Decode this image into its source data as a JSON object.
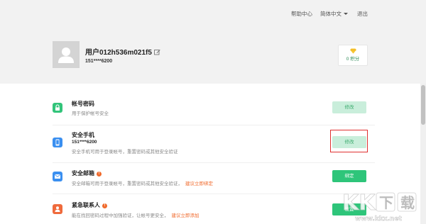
{
  "topnav": {
    "help": "帮助中心",
    "language": "简体中文",
    "logout": "退出"
  },
  "profile": {
    "username": "用户012h536m021f5",
    "phone": "151****6200",
    "points": "0 积分"
  },
  "rows": [
    {
      "title": "帐号密码",
      "desc": "用于保护帐号安全",
      "button": "修改"
    },
    {
      "title": "安全手机",
      "value": "151****6200",
      "desc": "安全手机可用于登录帐号，重置密码或其他安全验证",
      "button": "修改"
    },
    {
      "title": "安全邮箱",
      "desc": "安全邮箱可用于登录帐号，重置密码或其他安全验证，",
      "link": "建议立即绑定",
      "button": "绑定"
    },
    {
      "title": "紧急联系人",
      "desc": "能在找回密码过程中加强验证，让帐号更安全，",
      "link": "建议立即添加",
      "button": "设置"
    }
  ],
  "colors": {
    "accent_green": "#2ec57a",
    "light_green": "#c9eedb",
    "link_orange": "#f06a2c",
    "highlight_red": "#e03030"
  },
  "watermark": {
    "brand": "KK下载",
    "url": "www.kkx.net"
  }
}
